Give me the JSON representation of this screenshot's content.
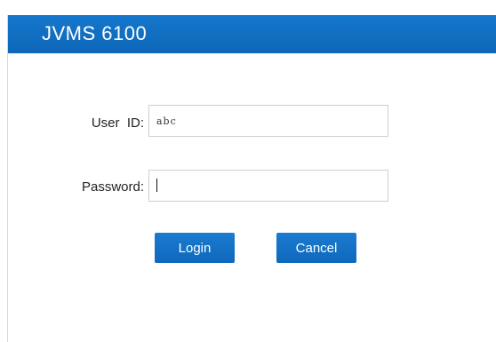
{
  "header": {
    "title": "JVMS 6100"
  },
  "form": {
    "user_id_label": "User  ID:",
    "user_id_value": "abc",
    "password_label": "Password:",
    "password_value": ""
  },
  "buttons": {
    "login_label": "Login",
    "cancel_label": "Cancel"
  },
  "colors": {
    "header_bg": "#0e67b8",
    "button_bg": "#1271c4",
    "text": "#222222",
    "border": "#cfcfcf"
  }
}
